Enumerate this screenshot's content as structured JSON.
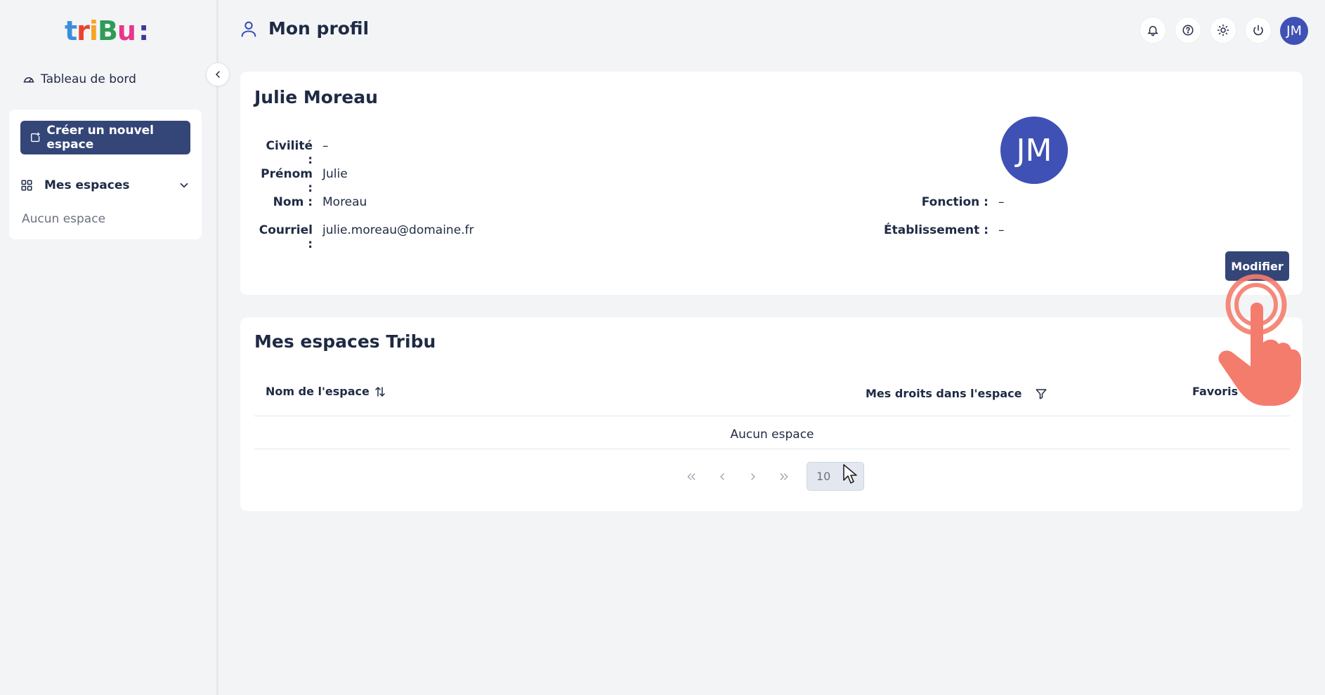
{
  "brand": {
    "logo_letters": [
      "t",
      "r",
      "i",
      "B",
      "u",
      ":"
    ],
    "colors": [
      "#3a8fd8",
      "#e8432e",
      "#f5a623",
      "#2e9c57",
      "#e9358a",
      "#3a3a9a"
    ]
  },
  "sidebar": {
    "dashboard_label": "Tableau de bord",
    "create_label": "Créer un nouvel espace",
    "spaces_label": "Mes espaces",
    "empty_label": "Aucun espace"
  },
  "header": {
    "title": "Mon profil",
    "avatar_initials": "JM",
    "icons": [
      "bell-icon",
      "help-icon",
      "sun-icon",
      "power-icon"
    ]
  },
  "profile": {
    "name": "Julie Moreau",
    "initials": "JM",
    "fields_left": [
      {
        "label": "Civilité :",
        "value": "–"
      },
      {
        "label": "Prénom :",
        "value": "Julie"
      },
      {
        "label": "Nom :",
        "value": "Moreau"
      },
      {
        "label": "Courriel :",
        "value": "julie.moreau@domaine.fr"
      }
    ],
    "fields_right": [
      {
        "label": "Fonction :",
        "value": "–"
      },
      {
        "label": "Établissement :",
        "value": "–"
      }
    ],
    "modify_label": "Modifier"
  },
  "spaces": {
    "title": "Mes espaces Tribu",
    "columns": [
      "Nom de l'espace",
      "Mes droits dans l'espace",
      "Favoris"
    ],
    "empty_label": "Aucun espace",
    "page_size": "10"
  },
  "colors": {
    "primary": "#344577",
    "avatar": "#3f51b5",
    "tap": "#f47c6c"
  }
}
